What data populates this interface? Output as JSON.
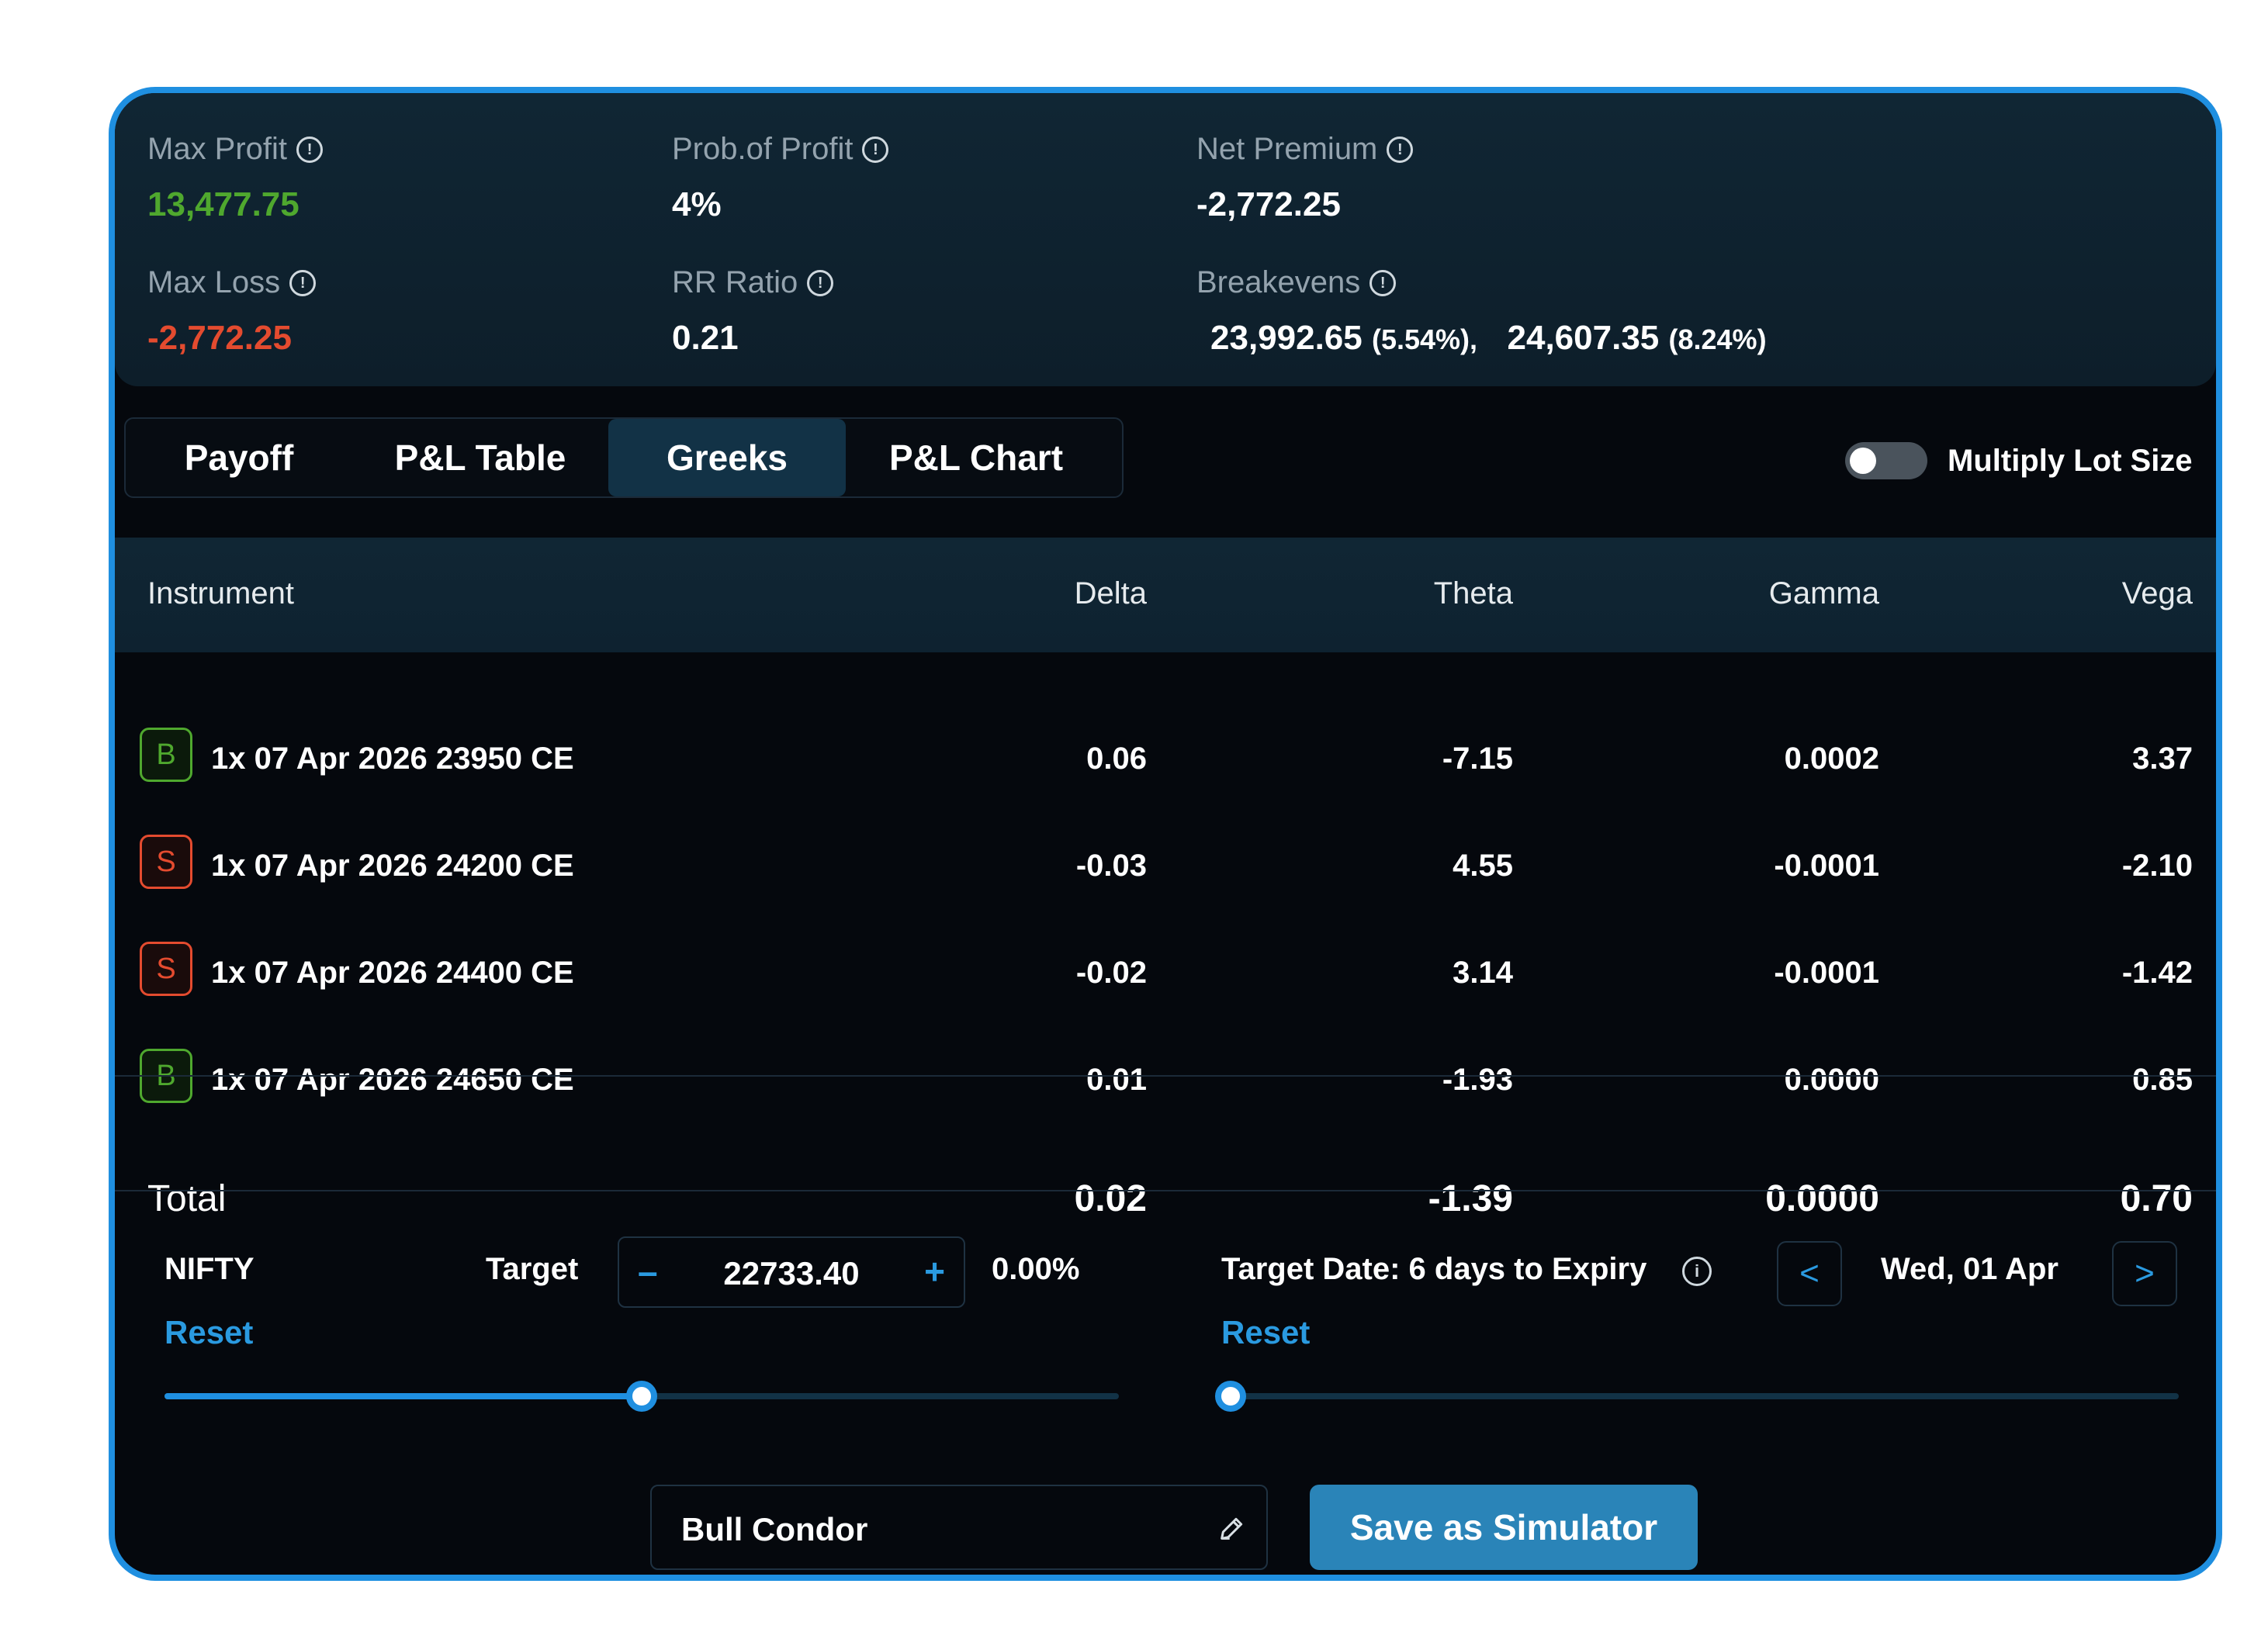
{
  "stats": {
    "max_profit": {
      "label": "Max Profit",
      "value": "13,477.75"
    },
    "prob_profit": {
      "label": "Prob.of Profit",
      "value": "4%"
    },
    "net_premium": {
      "label": "Net Premium",
      "value": "-2,772.25"
    },
    "max_loss": {
      "label": "Max Loss",
      "value": "-2,772.25"
    },
    "rr_ratio": {
      "label": "RR Ratio",
      "value": "0.21"
    },
    "breakevens": {
      "label": "Breakevens",
      "be1": "23,992.65",
      "be1_pct": "(5.54%),",
      "be2": "24,607.35",
      "be2_pct": "(8.24%)"
    },
    "colors": {
      "profit": "#4fa82e",
      "loss": "#e44b2f"
    }
  },
  "tabs": [
    {
      "label": "Payoff",
      "active": false
    },
    {
      "label": "P&L Table",
      "active": false
    },
    {
      "label": "Greeks",
      "active": true
    },
    {
      "label": "P&L Chart",
      "active": false
    }
  ],
  "toggle": {
    "label": "Multiply Lot Size",
    "on": false
  },
  "table": {
    "headers": {
      "instrument": "Instrument",
      "delta": "Delta",
      "theta": "Theta",
      "gamma": "Gamma",
      "vega": "Vega"
    },
    "rows": [
      {
        "side": "B",
        "instrument": "1x 07 Apr 2026 23950 CE",
        "delta": "0.06",
        "theta": "-7.15",
        "gamma": "0.0002",
        "vega": "3.37"
      },
      {
        "side": "S",
        "instrument": "1x 07 Apr 2026 24200 CE",
        "delta": "-0.03",
        "theta": "4.55",
        "gamma": "-0.0001",
        "vega": "-2.10"
      },
      {
        "side": "S",
        "instrument": "1x 07 Apr 2026 24400 CE",
        "delta": "-0.02",
        "theta": "3.14",
        "gamma": "-0.0001",
        "vega": "-1.42"
      },
      {
        "side": "B",
        "instrument": "1x 07 Apr 2026 24650 CE",
        "delta": "0.01",
        "theta": "-1.93",
        "gamma": "0.0000",
        "vega": "0.85"
      }
    ],
    "total": {
      "label": "Total",
      "delta": "0.02",
      "theta": "-1.39",
      "gamma": "0.0000",
      "vega": "0.70"
    }
  },
  "target": {
    "symbol": "NIFTY",
    "label": "Target",
    "minus": "–",
    "plus": "+",
    "value": "22733.40",
    "pct": "0.00%",
    "reset": "Reset",
    "slider_fraction": 0.5
  },
  "target_date": {
    "label": "Target Date: 6 days to Expiry",
    "prev": "<",
    "next": ">",
    "date": "Wed, 01 Apr",
    "reset": "Reset",
    "slider_fraction": 0.0
  },
  "footer": {
    "strategy_name": "Bull Condor",
    "save_label": "Save as Simulator"
  }
}
